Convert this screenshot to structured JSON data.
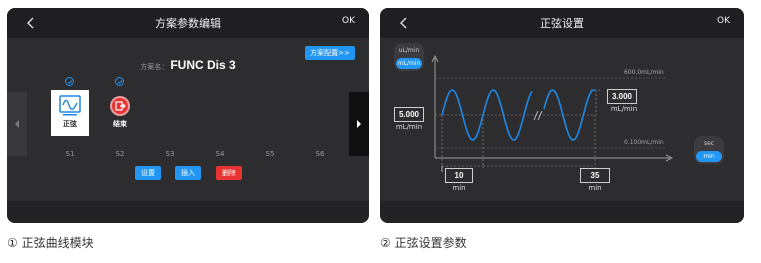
{
  "left_screen": {
    "title": "方案参数编辑",
    "ok_label": "OK",
    "scheme_label": "方案名：",
    "scheme_name": "FUNC Dis 3",
    "config_button": "方案配置>>",
    "modules": [
      {
        "name": "正弦",
        "icon": "sine-wave-icon"
      },
      {
        "name": "结束",
        "icon": "stop-exit-icon"
      }
    ],
    "slots": [
      "S1",
      "S2",
      "S3",
      "S4",
      "S5",
      "S6"
    ],
    "actions": {
      "set": "设置",
      "insert": "插入",
      "delete": "删除"
    }
  },
  "right_screen": {
    "title": "正弦设置",
    "ok_label": "OK",
    "flow_unit_options": [
      "uL/min",
      "mL/min"
    ],
    "flow_unit_selected": "mL/min",
    "max_limit": "600.0mL/min",
    "min_limit": "0.100mL/min",
    "amplitude_value": "3.000",
    "amplitude_unit": "mL/min",
    "baseline_value": "5.000",
    "baseline_unit": "mL/min",
    "period_value": "10",
    "period_unit": "min",
    "duration_value": "35",
    "duration_unit": "min",
    "time_unit_options": [
      "sec",
      "min"
    ],
    "time_unit_selected": "min"
  },
  "captions": {
    "left": "① 正弦曲线模块",
    "right": "② 正弦设置参数"
  },
  "colors": {
    "accent": "#2196f3",
    "danger": "#e83333",
    "wave": "#1e88e5"
  }
}
